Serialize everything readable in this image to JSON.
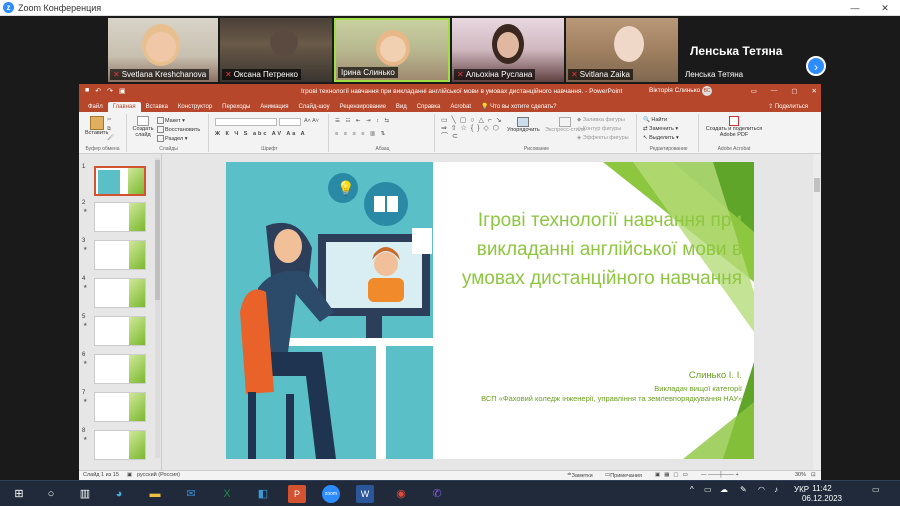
{
  "zoom": {
    "title": "Zoom Конференция",
    "participants": [
      {
        "name": "Svetlana Kreshchanova",
        "muted": true
      },
      {
        "name": "Оксана Петренко",
        "muted": true
      },
      {
        "name": "Ірина Слинько",
        "muted": false
      },
      {
        "name": "Альохіна Руслана",
        "muted": true
      },
      {
        "name": "Svitlana Zaika",
        "muted": true
      },
      {
        "name": "Ленська Тетяна",
        "muted": false
      }
    ],
    "big_name": "Ленська Тетяна"
  },
  "powerpoint": {
    "doc_title": "Ігрові технології навчання при викладанні англійської мови в умовах дистанційного навчання. - PowerPoint",
    "user": "Вікторія Слинько",
    "user_initials": "ВС",
    "tabs": [
      "Файл",
      "Главная",
      "Вставка",
      "Конструктор",
      "Переходы",
      "Анимация",
      "Слайд-шоу",
      "Рецензирование",
      "Вид",
      "Справка",
      "Acrobat"
    ],
    "active_tab": "Главная",
    "tell_me": "Что вы хотите сделать?",
    "share": "Поделиться",
    "ribbon": {
      "paste": "Вставить",
      "clipboard": "Буфер обмена",
      "create_slide": "Создать слайд",
      "layout": "Макет",
      "reset": "Восстановить",
      "section": "Раздел",
      "slides_group": "Слайды",
      "font_group": "Шрифт",
      "paragraph_group": "Абзац",
      "arrange": "Упорядочить",
      "quick_styles": "Экспресс-стили",
      "fill": "Заливка фигуры",
      "outline": "Контур фигуры",
      "effects": "Эффекты фигуры",
      "drawing_group": "Рисование",
      "find": "Найти",
      "replace": "Заменить",
      "select": "Выделить",
      "editing_group": "Редактирование",
      "pdf": "Создать и поделиться Adobe PDF",
      "acrobat_group": "Adobe Acrobat"
    },
    "slide_numbers": [
      "1",
      "2",
      "3",
      "4",
      "5",
      "6",
      "7",
      "8"
    ],
    "slide": {
      "title": "Ігрові технології навчання при викладанні англійської мови в умовах дистанційного навчання",
      "author": "Слинько І. І.",
      "position": "Викладач вищої категорії",
      "org": "ВСП «Фаховий коледж інженерії, управління та землевпорядкування НАУ»"
    },
    "status": {
      "slide_of": "Слайд 1 из 15",
      "language": "русский (Россия)",
      "notes": "Заметки",
      "comments": "Примечания",
      "zoom": "30%"
    }
  },
  "taskbar": {
    "language": "УКР",
    "time": "11:42",
    "date": "06.12.2023"
  }
}
